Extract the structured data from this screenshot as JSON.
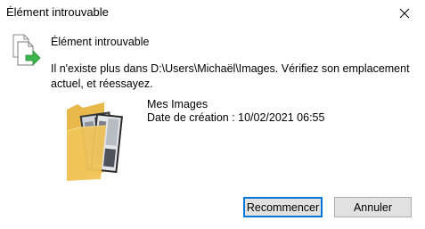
{
  "window": {
    "title": "Élément introuvable"
  },
  "dialog": {
    "heading": "Élément introuvable",
    "message": "Il n'existe plus dans D:\\Users\\Michaël\\Images. Vérifiez son emplacement actuel, et réessayez.",
    "item": {
      "name": "Mes Images",
      "date_line": "Date de création : 10/02/2021 06:55"
    },
    "icons": {
      "app": "file-move-icon",
      "item": "picture-folder-icon",
      "close": "close-icon"
    }
  },
  "buttons": {
    "retry_label": "Recommencer",
    "cancel_label": "Annuler"
  },
  "colors": {
    "accent": "#0078d7",
    "arrow_green": "#3cb54a",
    "folder": "#f0c45a"
  }
}
